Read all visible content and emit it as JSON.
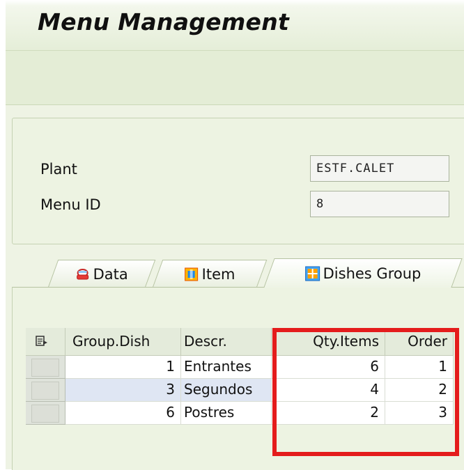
{
  "window": {
    "title": "Menu Management"
  },
  "header": {
    "plant_label": "Plant",
    "plant_value": "ESTF.CALET",
    "menu_id_label": "Menu ID",
    "menu_id_value": "8"
  },
  "tabs": [
    {
      "label": "Data",
      "icon": "tablecloth-icon",
      "active": false
    },
    {
      "label": "Item",
      "icon": "item-icon",
      "active": false
    },
    {
      "label": "Dishes Group",
      "icon": "grid-icon",
      "active": true
    }
  ],
  "table": {
    "columns": [
      "Group.Dish",
      "Descr.",
      "Qty.Items",
      "Order"
    ],
    "rows": [
      {
        "group": "1",
        "descr": "Entrantes",
        "qty": "6",
        "order": "1"
      },
      {
        "group": "3",
        "descr": "Segundos",
        "qty": "4",
        "order": "2"
      },
      {
        "group": "6",
        "descr": "Postres",
        "qty": "2",
        "order": "3"
      }
    ]
  },
  "colors": {
    "highlight_box": "#e41c1c",
    "selected_row": "#dfe6f3",
    "panel_bg": "#edf3e2"
  }
}
